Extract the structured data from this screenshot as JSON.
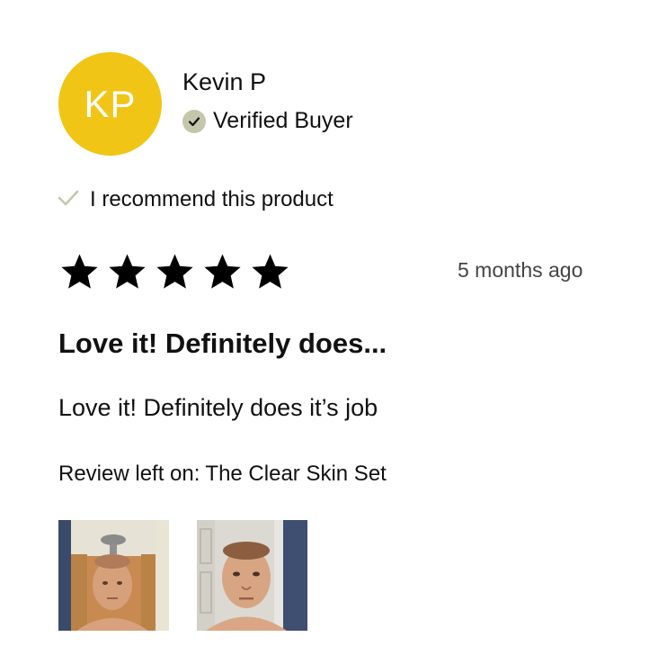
{
  "reviewer": {
    "initials": "KP",
    "name": "Kevin P",
    "verified_label": "Verified Buyer",
    "avatar_color": "#F1C515"
  },
  "recommendation": {
    "label": "I recommend this product",
    "check_color": "#C5C7AA"
  },
  "rating": {
    "stars": 5,
    "max": 5,
    "star_color": "#000000"
  },
  "review": {
    "date": "5 months ago",
    "title": "Love it! Definitely does...",
    "body": "Love it! Definitely does it’s job",
    "product_prefix": "Review left on:",
    "product_name": "The Clear Skin Set"
  },
  "photos": [
    {
      "icon": "review-photo-thumbnail"
    },
    {
      "icon": "review-photo-thumbnail"
    }
  ],
  "colors": {
    "verified_badge_bg": "#C5C7AA",
    "text_primary": "#111111",
    "text_secondary": "#444444"
  }
}
